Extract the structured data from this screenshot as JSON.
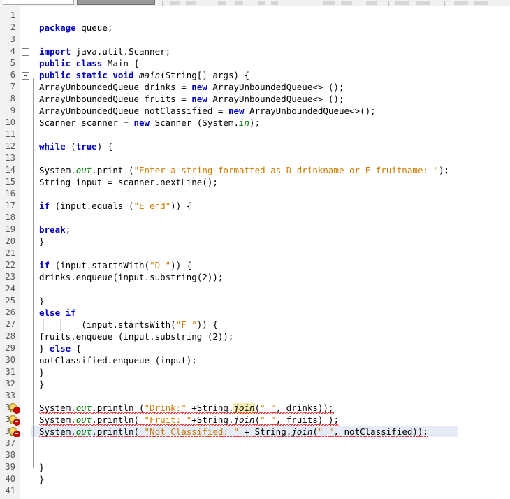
{
  "app": {
    "editor": "java-source-editor",
    "language": "java"
  },
  "toolbar": {
    "visible_fragment": true,
    "items": [
      "save-icon",
      "open-icon",
      "undo-icon",
      "redo-icon",
      "cut-icon",
      "copy-icon",
      "paste-icon",
      "run-icon",
      "debug-icon",
      "profile-icon",
      "build-icon"
    ],
    "search_field_value": ""
  },
  "colors": {
    "keyword": "#0000c0",
    "string": "#ce7b00",
    "field": "#008000",
    "text": "#000000",
    "gutter_bg": "#f2f2f2",
    "current_line": "#e6ecf7",
    "occurrence_highlight": "#f2eeb3",
    "margin_guide": "#f7a9a9",
    "error": "#d40000"
  },
  "editor": {
    "first_line": 1,
    "last_line": 41,
    "current_line": 36,
    "margin_column_x": 698,
    "fold_markers": [
      4,
      6
    ],
    "error_lines": [
      34,
      35,
      36
    ],
    "lines": [
      {
        "n": 1,
        "segments": []
      },
      {
        "n": 2,
        "indent": 2,
        "segments": [
          {
            "t": "package",
            "c": "kw"
          },
          {
            "t": " queue;",
            "c": ""
          }
        ]
      },
      {
        "n": 3,
        "segments": []
      },
      {
        "n": 4,
        "indent": 2,
        "fold": true,
        "segments": [
          {
            "t": "import",
            "c": "kw"
          },
          {
            "t": " java.util.Scanner;",
            "c": ""
          }
        ]
      },
      {
        "n": 5,
        "indent": 2,
        "segments": [
          {
            "t": "public class",
            "c": "kw"
          },
          {
            "t": " Main {",
            "c": ""
          }
        ]
      },
      {
        "n": 6,
        "indent": 2,
        "fold": true,
        "segments": [
          {
            "t": "public static void",
            "c": "kw"
          },
          {
            "t": " ",
            "c": ""
          },
          {
            "t": "main",
            "c": "ital"
          },
          {
            "t": "(String[] args) {",
            "c": ""
          }
        ]
      },
      {
        "n": 7,
        "indent": 2,
        "segments": [
          {
            "t": "ArrayUnboundedQueue drinks = ",
            "c": ""
          },
          {
            "t": "new",
            "c": "kw"
          },
          {
            "t": " ArrayUnboundedQueue<> ();",
            "c": ""
          }
        ]
      },
      {
        "n": 8,
        "indent": 2,
        "segments": [
          {
            "t": "ArrayUnboundedQueue fruits = ",
            "c": ""
          },
          {
            "t": "new",
            "c": "kw"
          },
          {
            "t": " ArrayUnboundedQueue<> ();",
            "c": ""
          }
        ]
      },
      {
        "n": 9,
        "indent": 2,
        "segments": [
          {
            "t": "ArrayUnboundedQueue notClassified = ",
            "c": ""
          },
          {
            "t": "new",
            "c": "kw"
          },
          {
            "t": " ArrayUnboundedQueue<>();",
            "c": ""
          }
        ]
      },
      {
        "n": 10,
        "indent": 2,
        "segments": [
          {
            "t": "Scanner scanner = ",
            "c": ""
          },
          {
            "t": "new",
            "c": "kw"
          },
          {
            "t": " Scanner (System.",
            "c": ""
          },
          {
            "t": "in",
            "c": "fld"
          },
          {
            "t": ");",
            "c": ""
          }
        ]
      },
      {
        "n": 11,
        "segments": []
      },
      {
        "n": 12,
        "indent": 2,
        "segments": [
          {
            "t": "while",
            "c": "kw"
          },
          {
            "t": " (",
            "c": ""
          },
          {
            "t": "true",
            "c": "kw"
          },
          {
            "t": ") {",
            "c": ""
          }
        ]
      },
      {
        "n": 13,
        "segments": []
      },
      {
        "n": 14,
        "indent": 2,
        "segments": [
          {
            "t": "System.",
            "c": ""
          },
          {
            "t": "out",
            "c": "fld"
          },
          {
            "t": ".print (",
            "c": ""
          },
          {
            "t": "\"Enter a string formatted as D drinkname or F fruitname: \"",
            "c": "str"
          },
          {
            "t": ");",
            "c": ""
          }
        ]
      },
      {
        "n": 15,
        "indent": 2,
        "segments": [
          {
            "t": "String input = scanner.nextLine();",
            "c": ""
          }
        ]
      },
      {
        "n": 16,
        "segments": []
      },
      {
        "n": 17,
        "indent": 2,
        "segments": [
          {
            "t": "if",
            "c": "kw"
          },
          {
            "t": " (input.equals (",
            "c": ""
          },
          {
            "t": "\"E end\"",
            "c": "str"
          },
          {
            "t": ")) {",
            "c": ""
          }
        ]
      },
      {
        "n": 18,
        "segments": []
      },
      {
        "n": 19,
        "indent": 2,
        "segments": [
          {
            "t": "break",
            "c": "kw"
          },
          {
            "t": ";",
            "c": ""
          }
        ]
      },
      {
        "n": 20,
        "indent": 2,
        "segments": [
          {
            "t": "}",
            "c": ""
          }
        ]
      },
      {
        "n": 21,
        "segments": []
      },
      {
        "n": 22,
        "indent": 2,
        "segments": [
          {
            "t": "if",
            "c": "kw"
          },
          {
            "t": " (input.startsWith(",
            "c": ""
          },
          {
            "t": "\"D \"",
            "c": "str"
          },
          {
            "t": ")) {",
            "c": ""
          }
        ]
      },
      {
        "n": 23,
        "indent": 2,
        "segments": [
          {
            "t": "drinks.enqueue(input.substring(2));",
            "c": ""
          }
        ]
      },
      {
        "n": 24,
        "segments": []
      },
      {
        "n": 25,
        "indent": 2,
        "segments": [
          {
            "t": "}",
            "c": ""
          }
        ]
      },
      {
        "n": 26,
        "indent": 2,
        "segments": [
          {
            "t": "else if",
            "c": "kw"
          }
        ]
      },
      {
        "n": 27,
        "indent": 2,
        "guides": true,
        "segments": [
          {
            "t": "        (input.startsWith(",
            "c": ""
          },
          {
            "t": "\"F \"",
            "c": "str"
          },
          {
            "t": ")) {",
            "c": ""
          }
        ]
      },
      {
        "n": 28,
        "indent": 2,
        "segments": [
          {
            "t": "fruits.enqueue (input.substring (2));",
            "c": ""
          }
        ]
      },
      {
        "n": 29,
        "indent": 2,
        "segments": [
          {
            "t": "} ",
            "c": ""
          },
          {
            "t": "else",
            "c": "kw"
          },
          {
            "t": " {",
            "c": ""
          }
        ]
      },
      {
        "n": 30,
        "indent": 2,
        "segments": [
          {
            "t": "notClassified.enqueue (input);",
            "c": ""
          }
        ]
      },
      {
        "n": 31,
        "indent": 2,
        "segments": [
          {
            "t": "}",
            "c": ""
          }
        ]
      },
      {
        "n": 32,
        "indent": 2,
        "segments": [
          {
            "t": "}",
            "c": ""
          }
        ]
      },
      {
        "n": 33,
        "segments": []
      },
      {
        "n": 34,
        "indent": 2,
        "error": true,
        "segments": [
          {
            "t": "System.",
            "c": "sq"
          },
          {
            "t": "out",
            "c": "fld ital sq"
          },
          {
            "t": ".println (",
            "c": "sq"
          },
          {
            "t": "\"Drink:\"",
            "c": "str sq"
          },
          {
            "t": " +String.",
            "c": "sq"
          },
          {
            "t": "join",
            "c": "ital hl sq"
          },
          {
            "t": "(",
            "c": "sq"
          },
          {
            "t": "\" \"",
            "c": "str sq"
          },
          {
            "t": ", drinks));",
            "c": "sq"
          }
        ]
      },
      {
        "n": 35,
        "indent": 2,
        "error": true,
        "segments": [
          {
            "t": "System.",
            "c": "sq"
          },
          {
            "t": "out",
            "c": "fld ital sq"
          },
          {
            "t": ".println( ",
            "c": "sq"
          },
          {
            "t": "\"Fruit: \"",
            "c": "str sq"
          },
          {
            "t": "+String.",
            "c": "sq"
          },
          {
            "t": "join",
            "c": "ital sq"
          },
          {
            "t": "(",
            "c": "sq"
          },
          {
            "t": "\" \"",
            "c": "str sq"
          },
          {
            "t": ", fruits) );",
            "c": "sq"
          }
        ]
      },
      {
        "n": 36,
        "indent": 2,
        "error": true,
        "current": true,
        "segments": [
          {
            "t": "System.",
            "c": "sq"
          },
          {
            "t": "out",
            "c": "fld ital sq"
          },
          {
            "t": ".println( ",
            "c": "sq"
          },
          {
            "t": "\"Not Classified: \"",
            "c": "str sq"
          },
          {
            "t": " + String.",
            "c": "sq"
          },
          {
            "t": "join",
            "c": "ital sq"
          },
          {
            "t": "(",
            "c": "sq"
          },
          {
            "t": "\" \"",
            "c": "str sq"
          },
          {
            "t": ", notClassified));",
            "c": "sq"
          }
        ]
      },
      {
        "n": 37,
        "segments": []
      },
      {
        "n": 38,
        "segments": []
      },
      {
        "n": 39,
        "indent": 2,
        "foldend": true,
        "segments": [
          {
            "t": "}",
            "c": ""
          }
        ]
      },
      {
        "n": 40,
        "indent": 2,
        "segments": [
          {
            "t": "}",
            "c": ""
          }
        ]
      },
      {
        "n": 41,
        "segments": []
      }
    ]
  }
}
